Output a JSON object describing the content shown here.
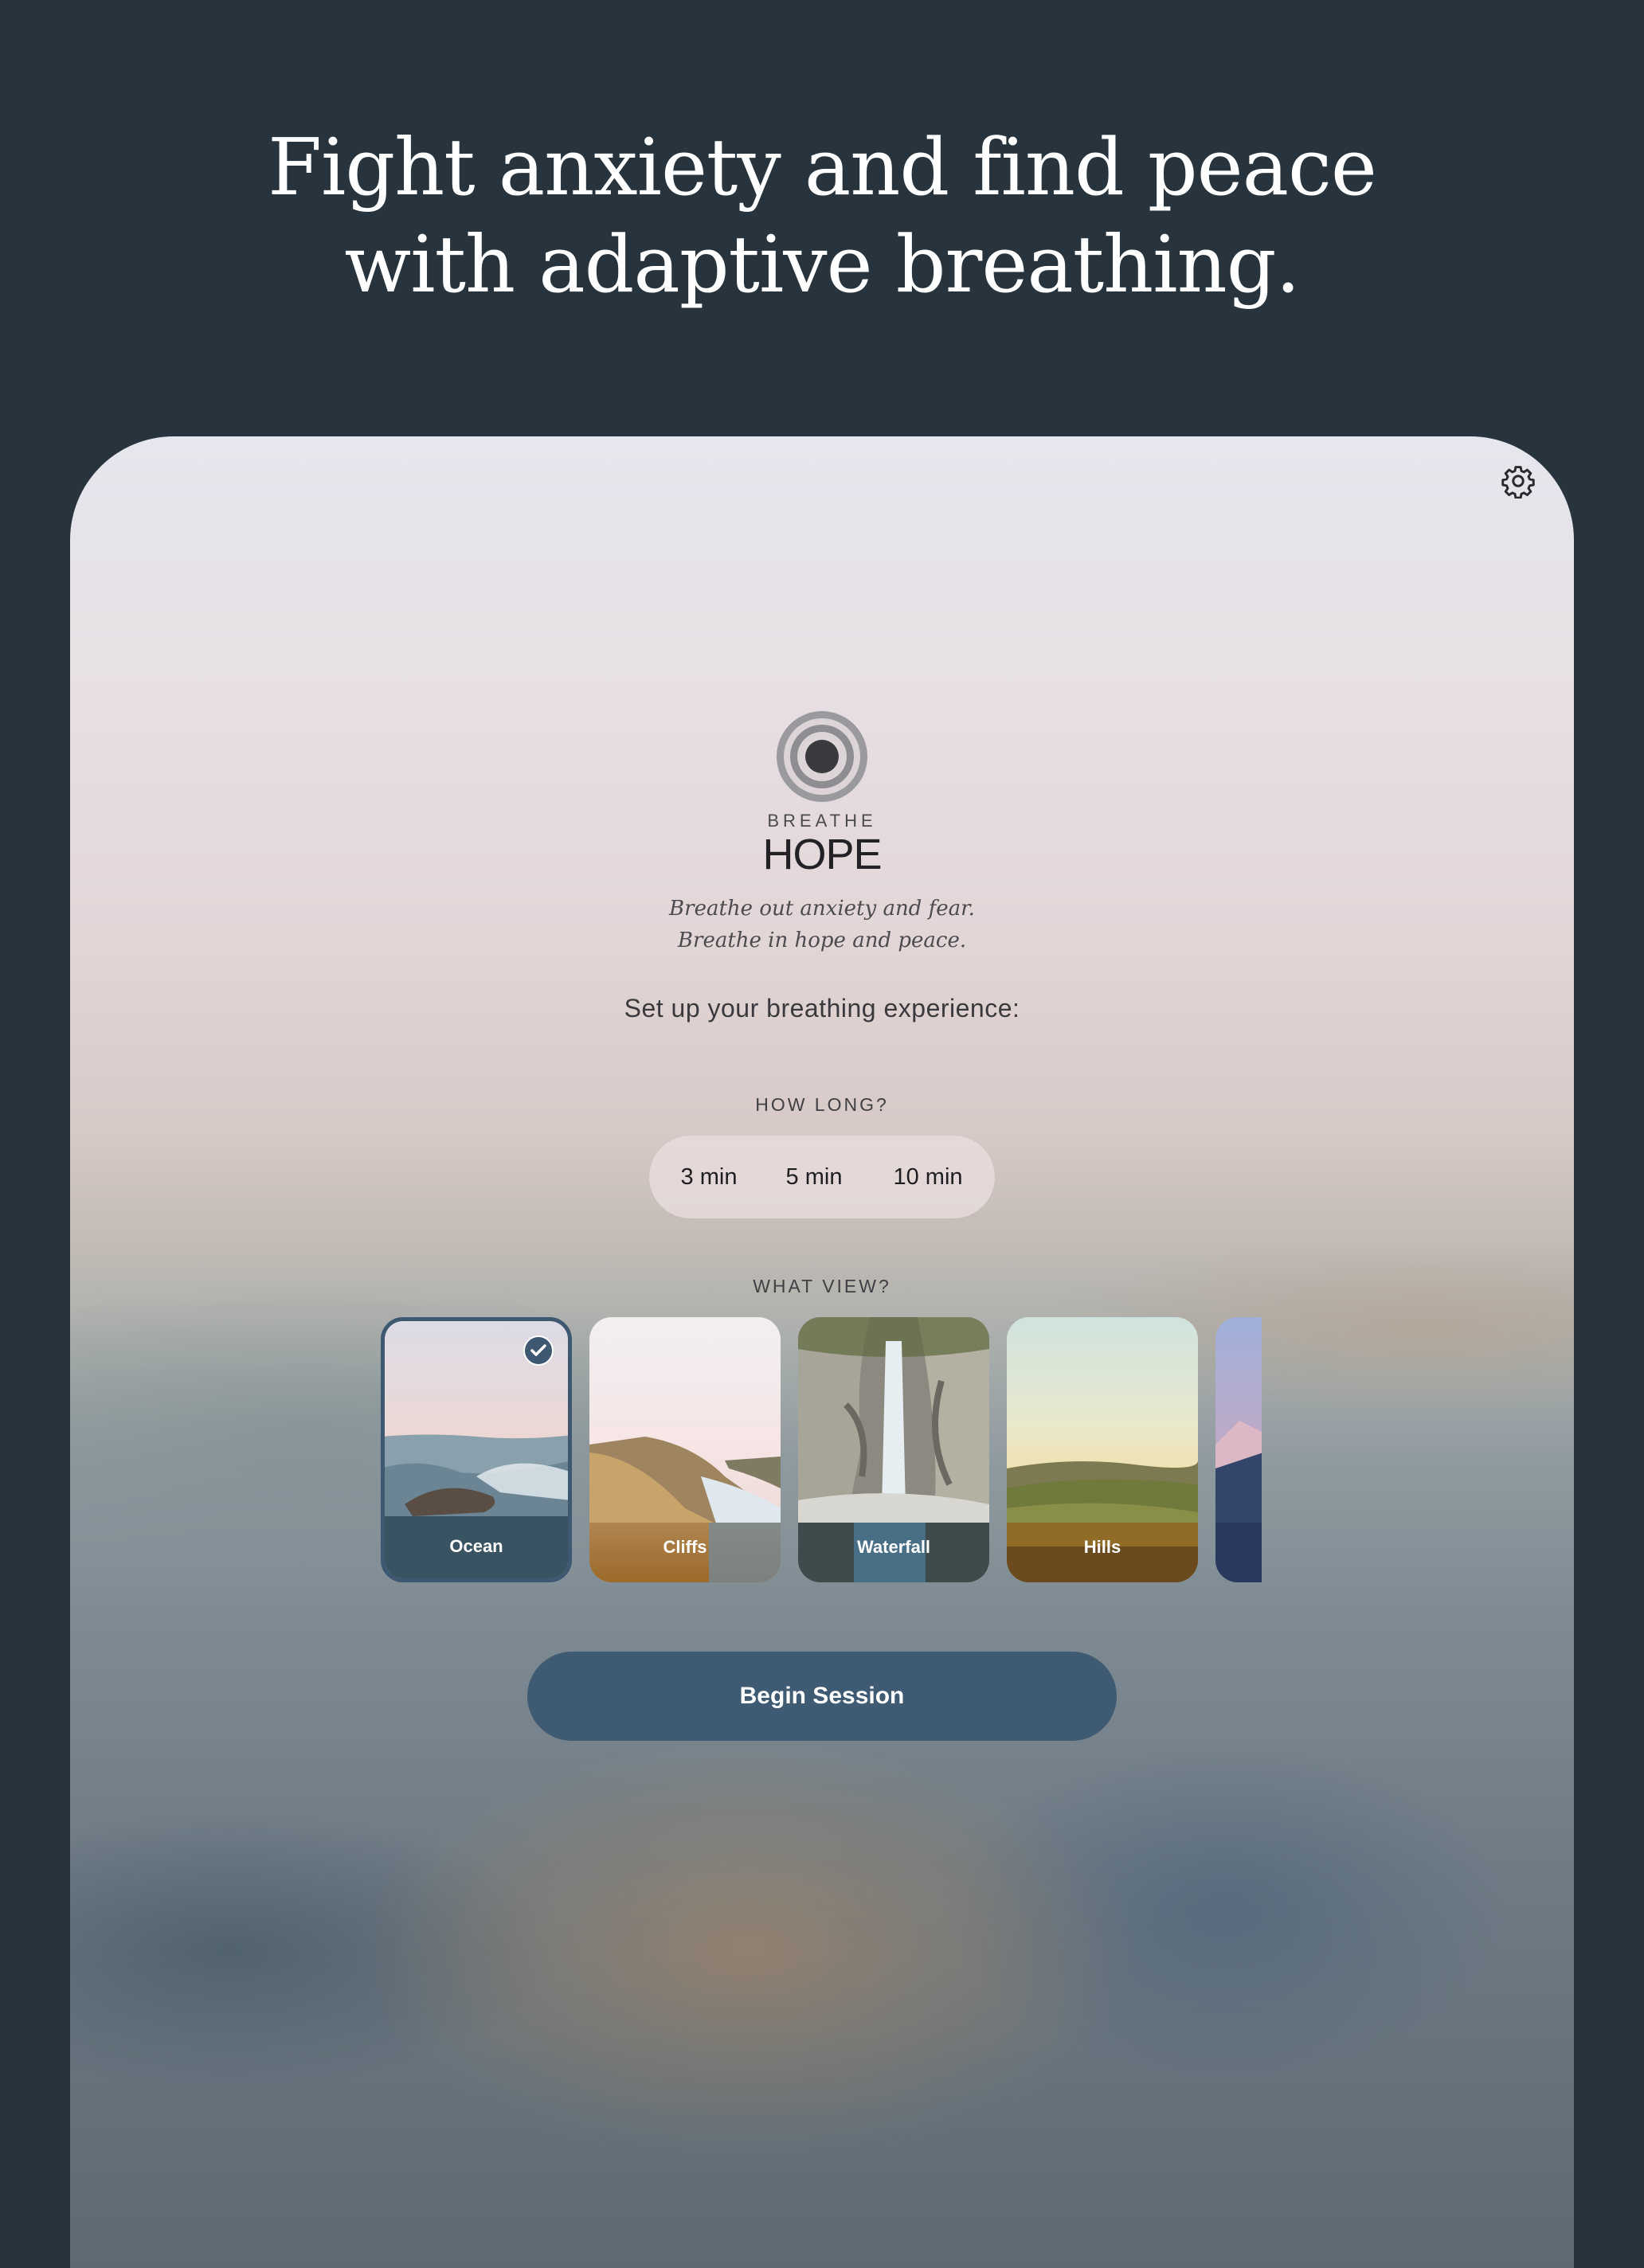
{
  "headline": {
    "line1": "Fight anxiety and find peace",
    "line2": "with adaptive breathing."
  },
  "app": {
    "settings_icon": "gear-icon",
    "logo_icon": "concentric-circles-icon",
    "brand_small": "BREATHE",
    "brand_big": "HOPE",
    "tagline_line1": "Breathe out anxiety and fear.",
    "tagline_line2": "Breathe in hope and peace.",
    "setup_prompt": "Set up your breathing experience:",
    "how_long": {
      "label": "HOW LONG?",
      "options": [
        "3 min",
        "5 min",
        "10 min"
      ]
    },
    "what_view": {
      "label": "WHAT VIEW?",
      "selected": "Ocean",
      "options": [
        "Ocean",
        "Cliffs",
        "Waterfall",
        "Hills"
      ]
    },
    "begin_button": "Begin Session"
  },
  "colors": {
    "outer_background": "#28343d",
    "accent": "#3f5a73",
    "headline_text": "#ffffff"
  }
}
